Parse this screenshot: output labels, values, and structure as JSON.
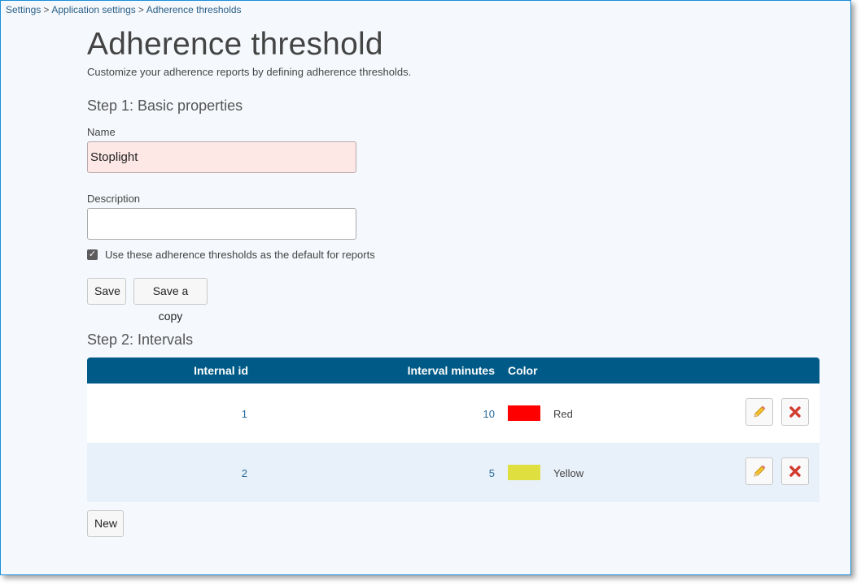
{
  "breadcrumb": {
    "items": [
      "Settings",
      "Application settings",
      "Adherence thresholds"
    ],
    "separator": ">"
  },
  "page": {
    "title": "Adherence threshold",
    "subtitle": "Customize your adherence reports by defining adherence thresholds."
  },
  "step1": {
    "title": "Step 1: Basic properties",
    "name_label": "Name",
    "name_value": "Stoplight",
    "description_label": "Description",
    "description_value": "",
    "default_checkbox_label": "Use these adherence thresholds as the default for reports",
    "default_checked": true,
    "save_label": "Save",
    "save_copy_label": "Save a copy"
  },
  "step2": {
    "title": "Step 2: Intervals",
    "columns": [
      "Internal id",
      "Interval minutes",
      "Color"
    ],
    "rows": [
      {
        "id": "1",
        "minutes": "10",
        "color_name": "Red",
        "color_hex": "#ff0000"
      },
      {
        "id": "2",
        "minutes": "5",
        "color_name": "Yellow",
        "color_hex": "#e0df40"
      }
    ],
    "new_label": "New"
  },
  "colors": {
    "header_bg": "#005a87",
    "link": "#2a6a9a",
    "error_field_bg": "#fde8e6"
  }
}
